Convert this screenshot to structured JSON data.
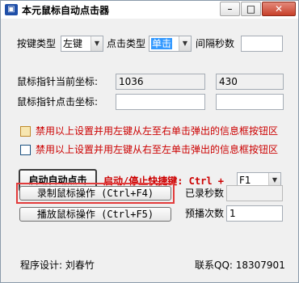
{
  "window": {
    "title": "本元鼠标自动点击器",
    "icon": "app-icon"
  },
  "titlebar": {
    "min": "–",
    "max": "□",
    "close": "✕"
  },
  "row1": {
    "key_type_label": "按键类型",
    "key_type_value": "左键",
    "click_type_label": "点击类型",
    "click_type_value": "单击",
    "interval_label": "间隔秒数",
    "interval_value": ""
  },
  "coords": {
    "current_label": "鼠标指针当前坐标:",
    "current_x": "1036",
    "current_y": "430",
    "click_label": "鼠标指针点击坐标:",
    "click_x": "",
    "click_y": ""
  },
  "options": {
    "opt1": "禁用以上设置并用左键从左至右单击弹出的信息框按钮区",
    "opt2": "禁用以上设置并用左键从右至左单击弹出的信息框按钮区"
  },
  "controls": {
    "start_button": "启动自动点击",
    "hotkey_label": "启动/停止快捷键: Ctrl + ",
    "hotkey_value": "F1"
  },
  "record": {
    "record_button": "录制鼠标操作 (Ctrl+F4)",
    "play_button": "播放鼠标操作 (Ctrl+F5)",
    "recorded_label": "已录秒数",
    "recorded_value": "",
    "repeat_label": "预播次数",
    "repeat_value": "1"
  },
  "footer": {
    "designer": "程序设计: 刘春竹",
    "contact": "联系QQ: 18307901"
  }
}
